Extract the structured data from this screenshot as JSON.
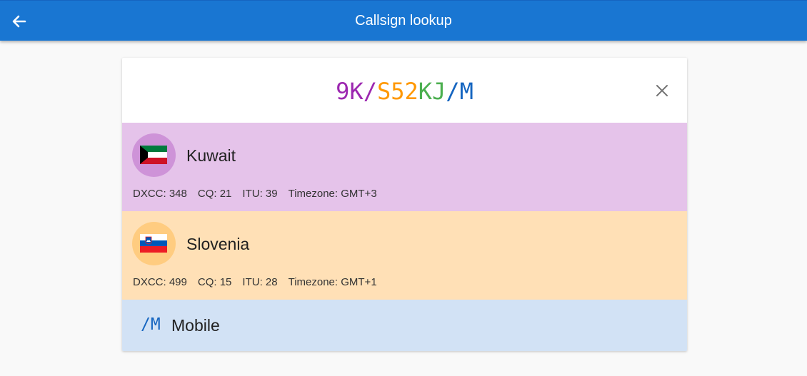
{
  "appbar": {
    "title": "Callsign lookup",
    "icon": "arrow-back-icon",
    "bg_color": "#1976d2"
  },
  "callsign": {
    "parts": [
      {
        "text": "9K/",
        "color": "#9c27b0"
      },
      {
        "text": "S52",
        "color": "#ff9800"
      },
      {
        "text": "KJ",
        "color": "#4caf50"
      },
      {
        "text": "/M",
        "color": "#1565c0"
      }
    ],
    "clear_icon": "close-icon"
  },
  "entities": [
    {
      "name": "Kuwait",
      "flag_icon": "kuwait-flag-icon",
      "bg_color": "#e5c3ea",
      "circle_color": "#ce93d8",
      "dxcc": "DXCC: 348",
      "cq": "CQ: 21",
      "itu": "ITU: 39",
      "timezone": "Timezone: GMT+3"
    },
    {
      "name": "Slovenia",
      "flag_icon": "slovenia-flag-icon",
      "bg_color": "#ffe0b6",
      "circle_color": "#ffcc80",
      "dxcc": "DXCC: 499",
      "cq": "CQ: 15",
      "itu": "ITU: 28",
      "timezone": "Timezone: GMT+1"
    }
  ],
  "suffix": {
    "code": "/M",
    "label": "Mobile",
    "color": "#1565c0"
  }
}
